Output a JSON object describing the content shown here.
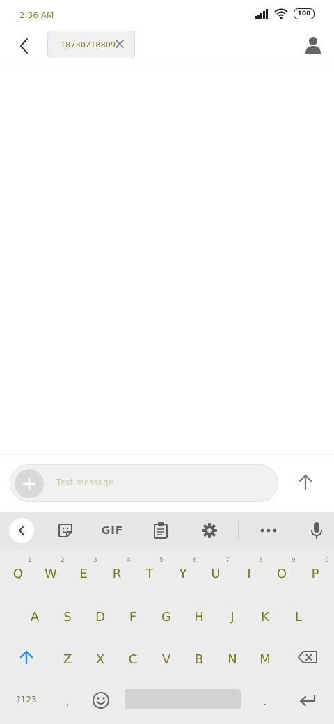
{
  "status_bar": {
    "time": "2:36 AM",
    "battery": "100"
  },
  "header": {
    "recipient": "18730218809"
  },
  "compose": {
    "placeholder": "Text message"
  },
  "keyboard": {
    "toolbar": {
      "gif": "GIF"
    },
    "row1": [
      {
        "key": "Q",
        "hint": "1"
      },
      {
        "key": "W",
        "hint": "2"
      },
      {
        "key": "E",
        "hint": "3"
      },
      {
        "key": "R",
        "hint": "4"
      },
      {
        "key": "T",
        "hint": "5"
      },
      {
        "key": "Y",
        "hint": "6"
      },
      {
        "key": "U",
        "hint": "7"
      },
      {
        "key": "I",
        "hint": "8"
      },
      {
        "key": "O",
        "hint": "9"
      },
      {
        "key": "P",
        "hint": "0"
      }
    ],
    "row2": [
      "A",
      "S",
      "D",
      "F",
      "G",
      "H",
      "J",
      "K",
      "L"
    ],
    "row3": [
      "Z",
      "X",
      "C",
      "V",
      "B",
      "N",
      "M"
    ],
    "symbols": "?123",
    "comma": ",",
    "period": "."
  },
  "colors": {
    "accent": "#2196f3",
    "key_text": "#7b7a1c"
  }
}
